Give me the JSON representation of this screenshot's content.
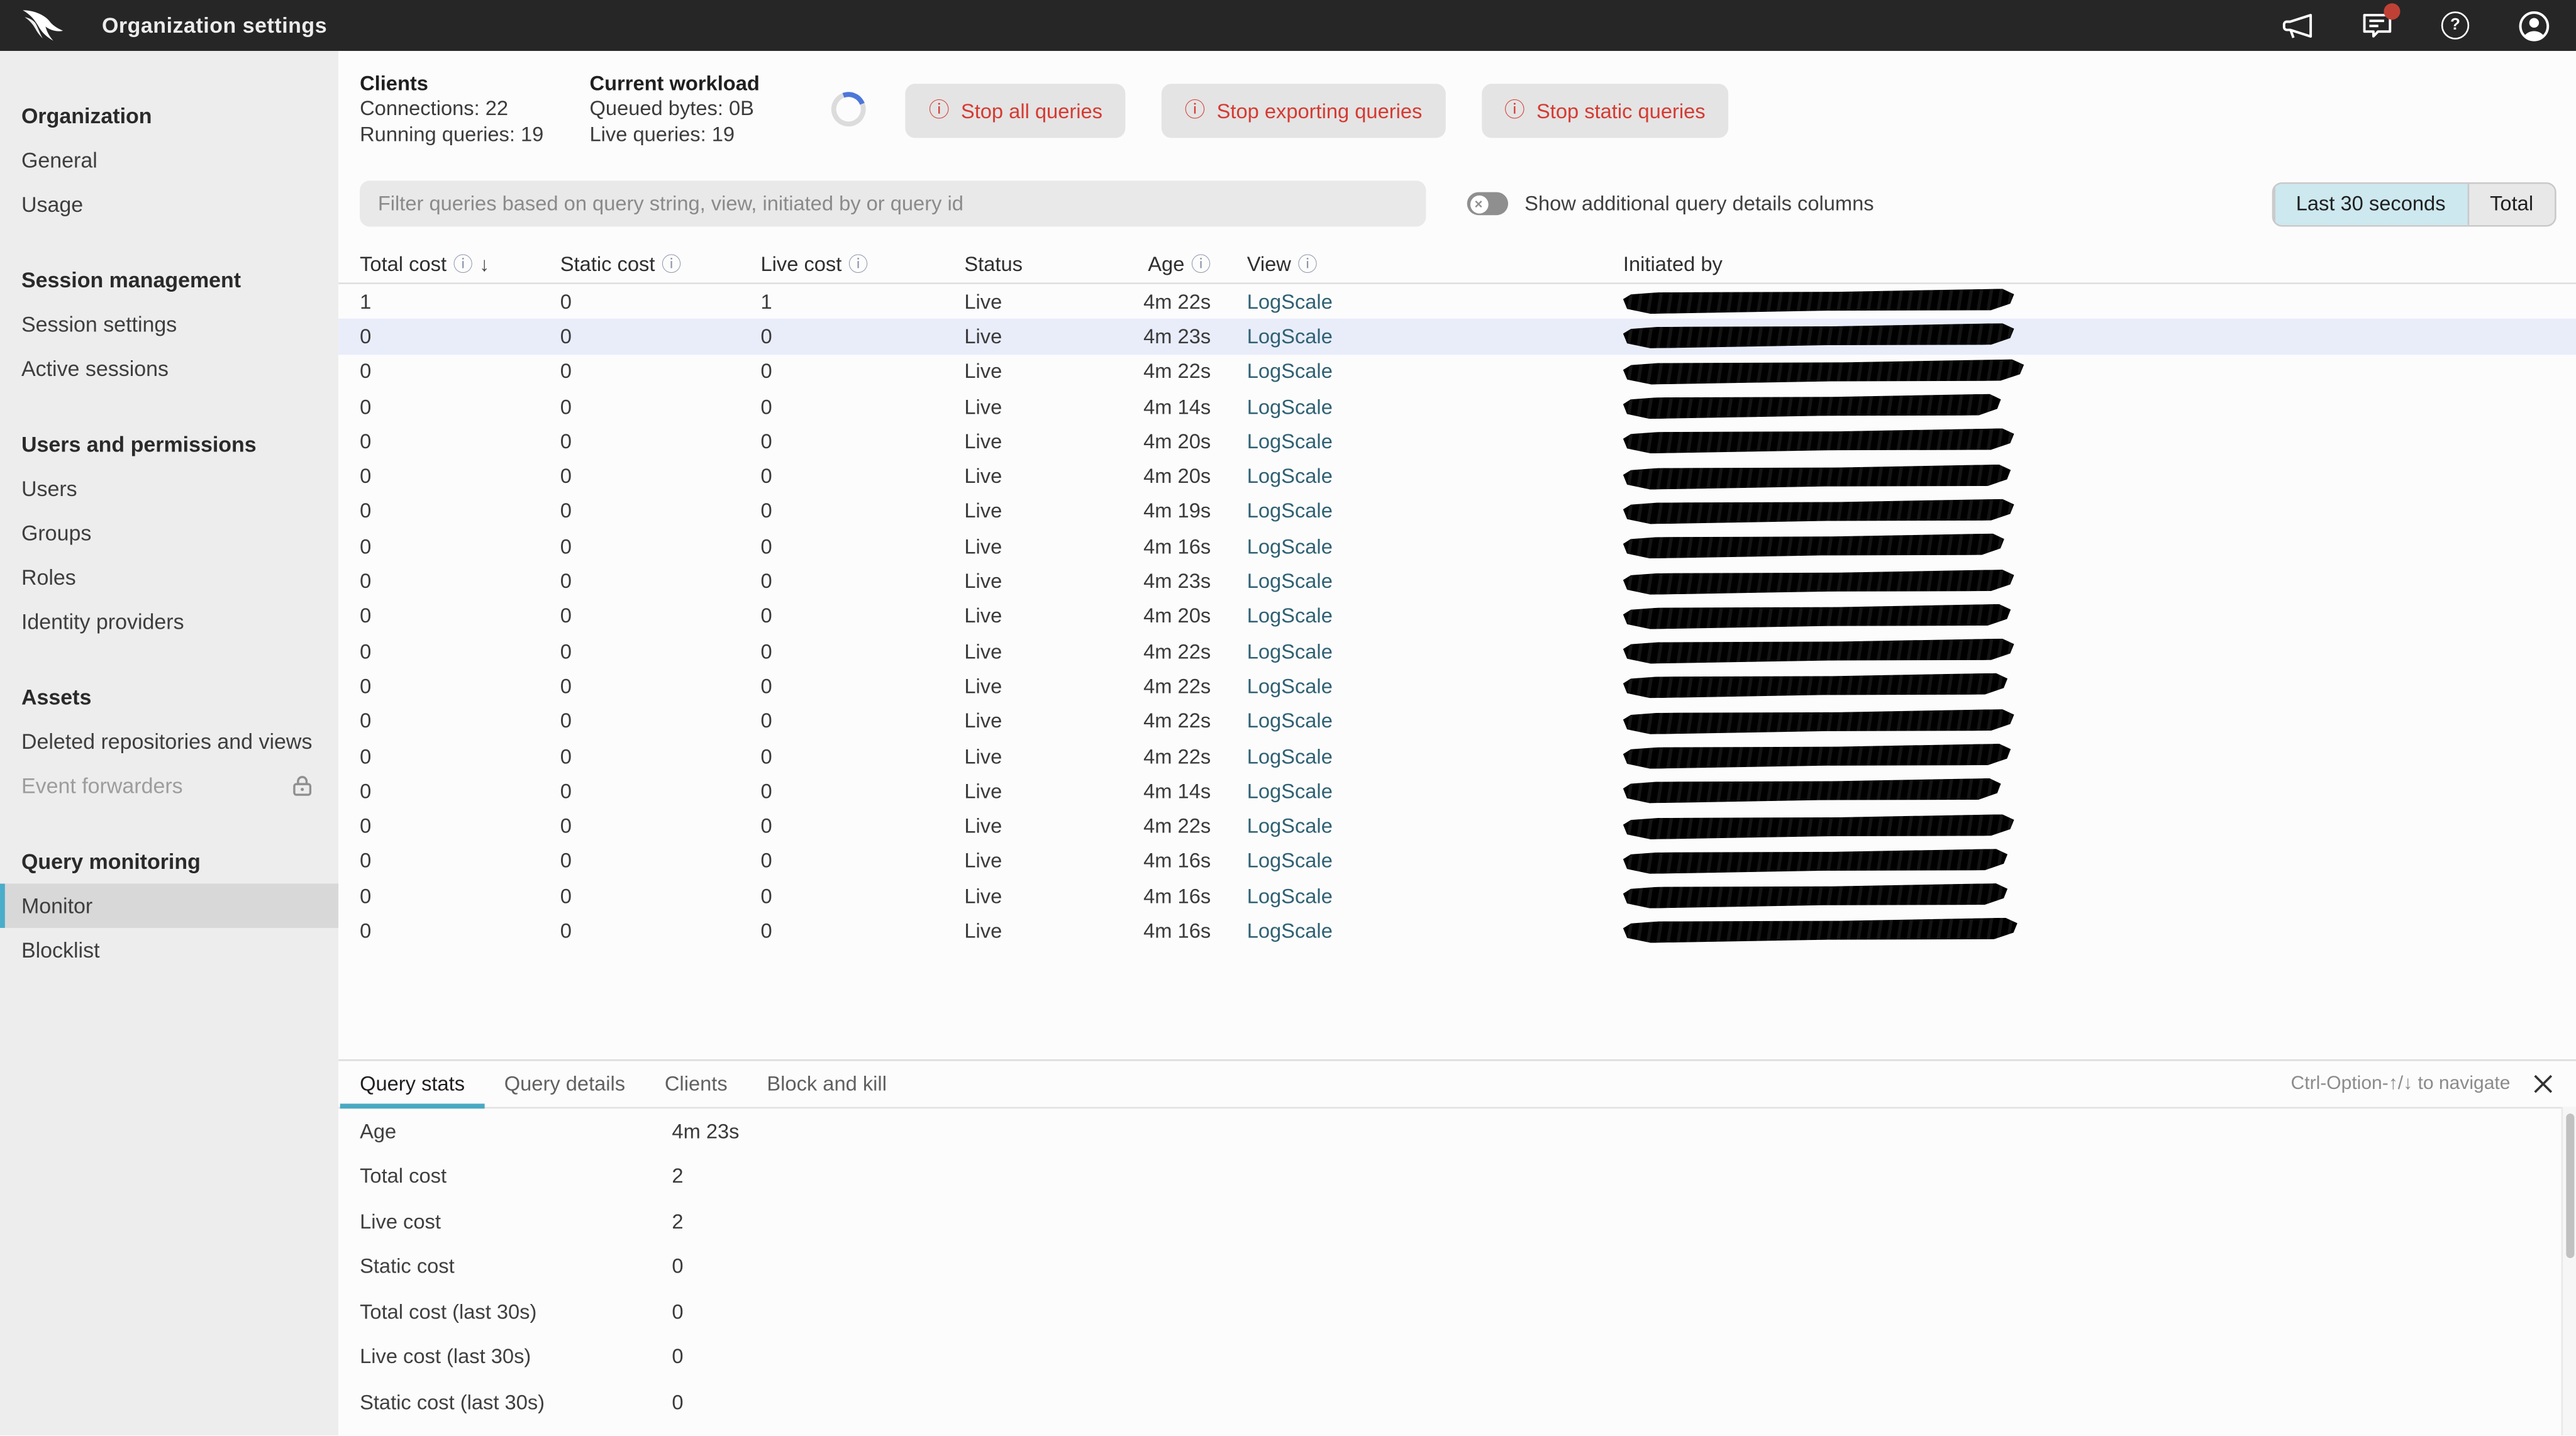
{
  "topbar": {
    "title": "Organization settings",
    "icons": {
      "logo": "crowdstrike-falcon",
      "announcements": "megaphone",
      "notifications": "chat-bubble-with-red-dot",
      "help": "question-circle",
      "account": "user-circle"
    }
  },
  "sidebar": {
    "sections": [
      {
        "heading": "Organization",
        "items": [
          {
            "label": "General"
          },
          {
            "label": "Usage"
          }
        ]
      },
      {
        "heading": "Session management",
        "items": [
          {
            "label": "Session settings"
          },
          {
            "label": "Active sessions"
          }
        ]
      },
      {
        "heading": "Users and permissions",
        "items": [
          {
            "label": "Users"
          },
          {
            "label": "Groups"
          },
          {
            "label": "Roles"
          },
          {
            "label": "Identity providers"
          }
        ]
      },
      {
        "heading": "Assets",
        "items": [
          {
            "label": "Deleted repositories and views"
          },
          {
            "label": "Event forwarders",
            "disabled": true,
            "lock": true
          }
        ]
      },
      {
        "heading": "Query monitoring",
        "items": [
          {
            "label": "Monitor",
            "active": true
          },
          {
            "label": "Blocklist"
          }
        ]
      }
    ]
  },
  "overview": {
    "clients": {
      "title": "Clients",
      "line1": "Connections: 22",
      "line2": "Running queries: 19"
    },
    "workload": {
      "title": "Current workload",
      "line1": "Queued bytes: 0B",
      "line2": "Live queries: 19"
    },
    "actions": [
      {
        "label": "Stop all queries"
      },
      {
        "label": "Stop exporting queries"
      },
      {
        "label": "Stop static queries"
      }
    ]
  },
  "filterbar": {
    "placeholder": "Filter queries based on query string, view, initiated by or query id",
    "toggle_label": "Show additional query details columns",
    "range_buttons": [
      {
        "label": "Last 30 seconds",
        "active": true
      },
      {
        "label": "Total"
      }
    ]
  },
  "table": {
    "headers": [
      {
        "label": "Total cost",
        "info": true,
        "sort": true,
        "cls": "col-total"
      },
      {
        "label": "Static cost",
        "info": true,
        "cls": "col-static"
      },
      {
        "label": "Live cost",
        "info": true,
        "cls": "col-live"
      },
      {
        "label": "Status",
        "cls": "col-status"
      },
      {
        "label": "Age",
        "info": true,
        "cls": "col-age"
      },
      {
        "label": "View",
        "info": true,
        "cls": "col-view"
      },
      {
        "label": "Initiated by",
        "cls": "col-init"
      }
    ],
    "rows": [
      {
        "total": "1",
        "statc": "0",
        "live": "1",
        "status": "Live",
        "age": "4m 22s",
        "view": "LogScale",
        "initiated_by": "redacted",
        "sw": 238
      },
      {
        "total": "0",
        "statc": "0",
        "live": "0",
        "status": "Live",
        "age": "4m 23s",
        "view": "LogScale",
        "initiated_by": "redacted",
        "sw": 238,
        "selected": true
      },
      {
        "total": "0",
        "statc": "0",
        "live": "0",
        "status": "Live",
        "age": "4m 22s",
        "view": "LogScale",
        "initiated_by": "redacted",
        "sw": 244
      },
      {
        "total": "0",
        "statc": "0",
        "live": "0",
        "status": "Live",
        "age": "4m 14s",
        "view": "LogScale",
        "initiated_by": "redacted",
        "sw": 230
      },
      {
        "total": "0",
        "statc": "0",
        "live": "0",
        "status": "Live",
        "age": "4m 20s",
        "view": "LogScale",
        "initiated_by": "redacted",
        "sw": 238
      },
      {
        "total": "0",
        "statc": "0",
        "live": "0",
        "status": "Live",
        "age": "4m 20s",
        "view": "LogScale",
        "initiated_by": "redacted",
        "sw": 236
      },
      {
        "total": "0",
        "statc": "0",
        "live": "0",
        "status": "Live",
        "age": "4m 19s",
        "view": "LogScale",
        "initiated_by": "redacted",
        "sw": 238
      },
      {
        "total": "0",
        "statc": "0",
        "live": "0",
        "status": "Live",
        "age": "4m 16s",
        "view": "LogScale",
        "initiated_by": "redacted",
        "sw": 232
      },
      {
        "total": "0",
        "statc": "0",
        "live": "0",
        "status": "Live",
        "age": "4m 23s",
        "view": "LogScale",
        "initiated_by": "redacted",
        "sw": 238
      },
      {
        "total": "0",
        "statc": "0",
        "live": "0",
        "status": "Live",
        "age": "4m 20s",
        "view": "LogScale",
        "initiated_by": "redacted",
        "sw": 236
      },
      {
        "total": "0",
        "statc": "0",
        "live": "0",
        "status": "Live",
        "age": "4m 22s",
        "view": "LogScale",
        "initiated_by": "redacted",
        "sw": 238
      },
      {
        "total": "0",
        "statc": "0",
        "live": "0",
        "status": "Live",
        "age": "4m 22s",
        "view": "LogScale",
        "initiated_by": "redacted",
        "sw": 234
      },
      {
        "total": "0",
        "statc": "0",
        "live": "0",
        "status": "Live",
        "age": "4m 22s",
        "view": "LogScale",
        "initiated_by": "redacted",
        "sw": 238
      },
      {
        "total": "0",
        "statc": "0",
        "live": "0",
        "status": "Live",
        "age": "4m 22s",
        "view": "LogScale",
        "initiated_by": "redacted",
        "sw": 236
      },
      {
        "total": "0",
        "statc": "0",
        "live": "0",
        "status": "Live",
        "age": "4m 14s",
        "view": "LogScale",
        "initiated_by": "redacted",
        "sw": 230
      },
      {
        "total": "0",
        "statc": "0",
        "live": "0",
        "status": "Live",
        "age": "4m 22s",
        "view": "LogScale",
        "initiated_by": "redacted",
        "sw": 238
      },
      {
        "total": "0",
        "statc": "0",
        "live": "0",
        "status": "Live",
        "age": "4m 16s",
        "view": "LogScale",
        "initiated_by": "redacted",
        "sw": 234
      },
      {
        "total": "0",
        "statc": "0",
        "live": "0",
        "status": "Live",
        "age": "4m 16s",
        "view": "LogScale",
        "initiated_by": "redacted",
        "sw": 234
      },
      {
        "total": "0",
        "statc": "0",
        "live": "0",
        "status": "Live",
        "age": "4m 16s",
        "view": "LogScale",
        "initiated_by": "redacted",
        "sw": 240
      }
    ]
  },
  "details": {
    "tabs": [
      {
        "label": "Query stats",
        "active": true
      },
      {
        "label": "Query details"
      },
      {
        "label": "Clients"
      },
      {
        "label": "Block and kill"
      }
    ],
    "hint": "Ctrl-Option-↑/↓ to navigate",
    "rows": [
      {
        "label": "Age",
        "value": "4m 23s"
      },
      {
        "label": "Total cost",
        "value": "2"
      },
      {
        "label": "Live cost",
        "value": "2"
      },
      {
        "label": "Static cost",
        "value": "0"
      },
      {
        "label": "Total cost (last 30s)",
        "value": "0"
      },
      {
        "label": "Live cost (last 30s)",
        "value": "0"
      },
      {
        "label": "Static cost (last 30s)",
        "value": "0"
      }
    ]
  },
  "colors": {
    "topbar_bg": "#262626",
    "accent_teal": "#4aadc9",
    "danger_red": "#d63a32",
    "link_teal": "#2f6173",
    "selected_row": "#e9edfa",
    "notification_dot": "#bf4136",
    "spinner_blue": "#4d76d9"
  }
}
